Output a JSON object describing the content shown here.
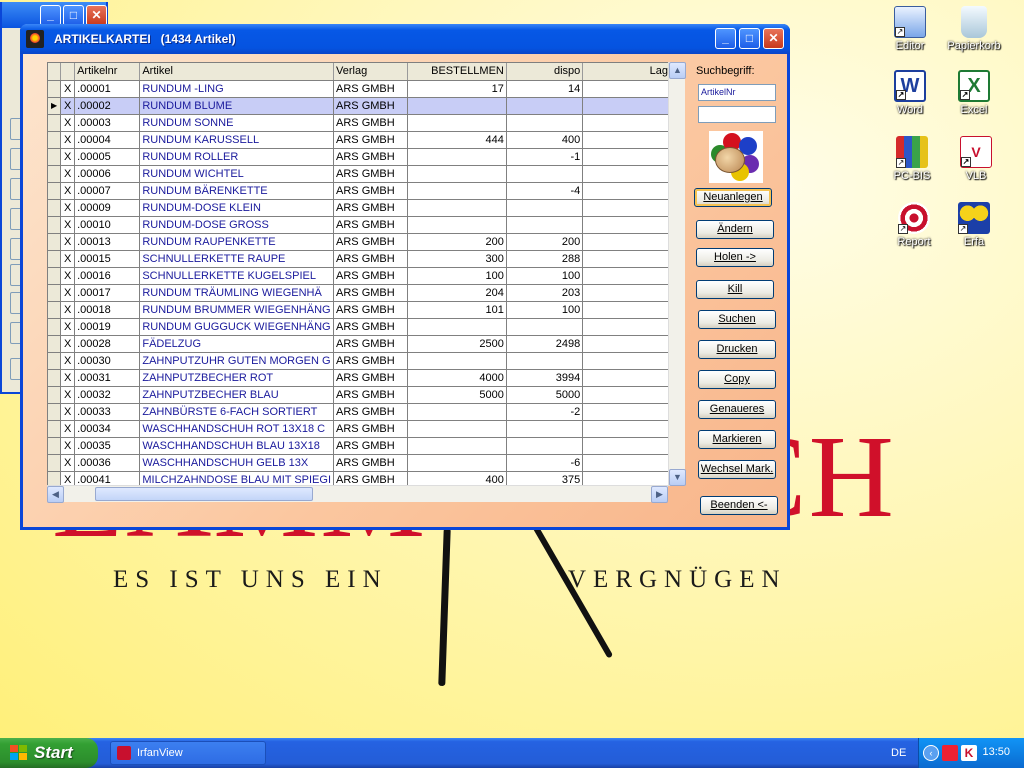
{
  "colors": {
    "accent": "#0a54e0",
    "wallpaper": "#fff200",
    "brand_red": "#d0102a",
    "selected_row": "#c8cdf6",
    "article_text": "#1a1a9c"
  },
  "wallpaper": {
    "big_left": "LAMM",
    "big_right": "BUCH",
    "tag_left": "ES IST UNS EIN",
    "tag_right": "VERGNÜGEN"
  },
  "desktop_icons": [
    {
      "label": "Editor",
      "icon": "notepad-icon"
    },
    {
      "label": "Papierkorb",
      "icon": "recycle-bin-icon"
    },
    {
      "label": "Word",
      "icon": "word-icon"
    },
    {
      "label": "Excel",
      "icon": "excel-icon"
    },
    {
      "label": "PC-BIS",
      "icon": "books-icon"
    },
    {
      "label": "VLB",
      "icon": "vlb-icon"
    },
    {
      "label": "Report",
      "icon": "target-icon"
    },
    {
      "label": "Erfa",
      "icon": "people-icon"
    }
  ],
  "window": {
    "title": "ARTIKELKARTEI   (1434 Artikel)",
    "columns": [
      "Artikelnr",
      "Artikel",
      "Verlag",
      "BESTELLMEN",
      "dispo",
      "Lag"
    ],
    "check_mark": "X",
    "row_pointer": "▶",
    "rows": [
      {
        "nr": ".00001",
        "artikel": "RUNDUM -LING",
        "verlag": "ARS GMBH",
        "bestell": "17",
        "dispo": "14"
      },
      {
        "nr": ".00002",
        "artikel": "RUNDUM BLUME",
        "verlag": "ARS GMBH",
        "bestell": "",
        "dispo": ""
      },
      {
        "nr": ".00003",
        "artikel": "RUNDUM SONNE",
        "verlag": "ARS GMBH",
        "bestell": "",
        "dispo": ""
      },
      {
        "nr": ".00004",
        "artikel": "RUNDUM KARUSSELL",
        "verlag": "ARS GMBH",
        "bestell": "444",
        "dispo": "400"
      },
      {
        "nr": ".00005",
        "artikel": "RUNDUM ROLLER",
        "verlag": "ARS GMBH",
        "bestell": "",
        "dispo": "-1"
      },
      {
        "nr": ".00006",
        "artikel": "RUNDUM WICHTEL",
        "verlag": "ARS GMBH",
        "bestell": "",
        "dispo": ""
      },
      {
        "nr": ".00007",
        "artikel": "RUNDUM BÄRENKETTE",
        "verlag": "ARS GMBH",
        "bestell": "",
        "dispo": "-4"
      },
      {
        "nr": ".00009",
        "artikel": "RUNDUM-DOSE KLEIN",
        "verlag": "ARS GMBH",
        "bestell": "",
        "dispo": ""
      },
      {
        "nr": ".00010",
        "artikel": "RUNDUM-DOSE GROSS",
        "verlag": "ARS GMBH",
        "bestell": "",
        "dispo": ""
      },
      {
        "nr": ".00013",
        "artikel": "RUNDUM RAUPENKETTE",
        "verlag": "ARS GMBH",
        "bestell": "200",
        "dispo": "200"
      },
      {
        "nr": ".00015",
        "artikel": "SCHNULLERKETTE RAUPE",
        "verlag": "ARS GMBH",
        "bestell": "300",
        "dispo": "288"
      },
      {
        "nr": ".00016",
        "artikel": "SCHNULLERKETTE KUGELSPIEL",
        "verlag": "ARS GMBH",
        "bestell": "100",
        "dispo": "100"
      },
      {
        "nr": ".00017",
        "artikel": "RUNDUM TRÄUMLING WIEGENHÄ",
        "verlag": "ARS GMBH",
        "bestell": "204",
        "dispo": "203"
      },
      {
        "nr": ".00018",
        "artikel": "RUNDUM BRUMMER WIEGENHÄNG",
        "verlag": "ARS GMBH",
        "bestell": "101",
        "dispo": "100"
      },
      {
        "nr": ".00019",
        "artikel": "RUNDUM GUGGUCK WIEGENHÄNG",
        "verlag": "ARS GMBH",
        "bestell": "",
        "dispo": ""
      },
      {
        "nr": ".00028",
        "artikel": "FÄDELZUG",
        "verlag": "ARS GMBH",
        "bestell": "2500",
        "dispo": "2498"
      },
      {
        "nr": ".00030",
        "artikel": "ZAHNPUTZUHR GUTEN MORGEN G",
        "verlag": "ARS GMBH",
        "bestell": "",
        "dispo": ""
      },
      {
        "nr": ".00031",
        "artikel": "ZAHNPUTZBECHER ROT",
        "verlag": "ARS GMBH",
        "bestell": "4000",
        "dispo": "3994"
      },
      {
        "nr": ".00032",
        "artikel": "ZAHNPUTZBECHER BLAU",
        "verlag": "ARS GMBH",
        "bestell": "5000",
        "dispo": "5000"
      },
      {
        "nr": ".00033",
        "artikel": "ZAHNBÜRSTE 6-FACH SORTIERT",
        "verlag": "ARS GMBH",
        "bestell": "",
        "dispo": "-2"
      },
      {
        "nr": ".00034",
        "artikel": "WASCHHANDSCHUH ROT 13X18 C",
        "verlag": "ARS GMBH",
        "bestell": "",
        "dispo": ""
      },
      {
        "nr": ".00035",
        "artikel": "WASCHHANDSCHUH BLAU 13X18",
        "verlag": "ARS GMBH",
        "bestell": "",
        "dispo": ""
      },
      {
        "nr": ".00036",
        "artikel": "WASCHHANDSCHUH GELB 13X",
        "verlag": "ARS GMBH",
        "bestell": "",
        "dispo": "-6"
      },
      {
        "nr": ".00041",
        "artikel": "MILCHZAHNDOSE BLAU MIT SPIEGI",
        "verlag": "ARS GMBH",
        "bestell": "400",
        "dispo": "375"
      }
    ],
    "selected_row": 1
  },
  "panel": {
    "search_label": "Suchbegriff:",
    "search_field_value": "ArtikelNr",
    "search_value": "",
    "buttons": [
      "Neuanlegen",
      "Ändern",
      "Holen ->",
      "Kill",
      "Suchen",
      "Drucken",
      "Copy",
      "Genaueres",
      "Markieren",
      "Wechsel Mark.",
      "Beenden <-"
    ]
  },
  "taskbar": {
    "start_label": "Start",
    "task_label": "IrfanView",
    "language": "DE",
    "clock": "13:50"
  }
}
